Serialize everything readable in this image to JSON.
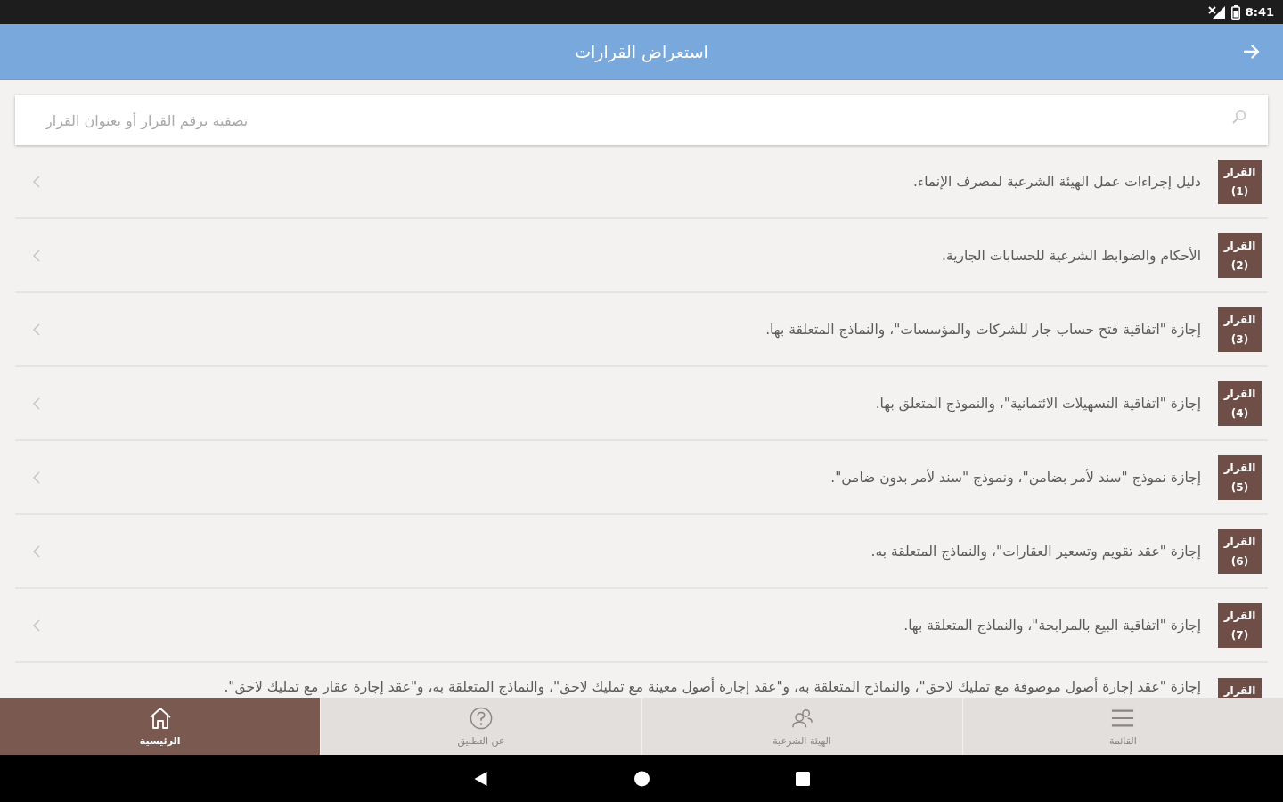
{
  "status_bar": {
    "time": "8:41"
  },
  "app_bar": {
    "title": "استعراض القرارات"
  },
  "search": {
    "placeholder": "تصفية برقم القرار أو بعنوان القرار"
  },
  "decisions": [
    {
      "label": "القرار",
      "number": "(1)",
      "title": "دليل إجراءات عمل الهيئة الشرعية لمصرف الإنماء."
    },
    {
      "label": "القرار",
      "number": "(2)",
      "title": "الأحكام والضوابط الشرعية للحسابات الجارية."
    },
    {
      "label": "القرار",
      "number": "(3)",
      "title": "إجازة \"اتفاقية فتح حساب جار للشركات والمؤسسات\"، والنماذج المتعلقة بها."
    },
    {
      "label": "القرار",
      "number": "(4)",
      "title": "إجازة \"اتفاقية التسهيلات الائتمانية\"، والنموذج المتعلق بها."
    },
    {
      "label": "القرار",
      "number": "(5)",
      "title": "إجازة نموذج \"سند لأمر بضامن\"، ونموذج \"سند لأمر بدون ضامن\"."
    },
    {
      "label": "القرار",
      "number": "(6)",
      "title": "إجازة \"عقد تقويم وتسعير العقارات\"، والنماذج المتعلقة به."
    },
    {
      "label": "القرار",
      "number": "(7)",
      "title": "إجازة \"اتفاقية البيع بالمرابحة\"، والنماذج المتعلقة بها."
    },
    {
      "label": "القرار",
      "title": "إجازة \"عقد إجارة أصول موصوفة مع تمليك لاحق\"، والنماذج المتعلقة به، و\"عقد إجارة أصول معينة مع تمليك لاحق\"، والنماذج المتعلقة به، و\"عقد إجارة عقار مع تمليك لاحق\"."
    }
  ],
  "bottom_tabs": [
    {
      "kind": "menu",
      "label": "القائمة",
      "selected": false
    },
    {
      "kind": "board",
      "label": "الهيئة الشرعية",
      "selected": false
    },
    {
      "kind": "help",
      "label": "عن التطبيق",
      "selected": false
    },
    {
      "kind": "home",
      "label": "الرئيسية",
      "selected": true
    }
  ]
}
